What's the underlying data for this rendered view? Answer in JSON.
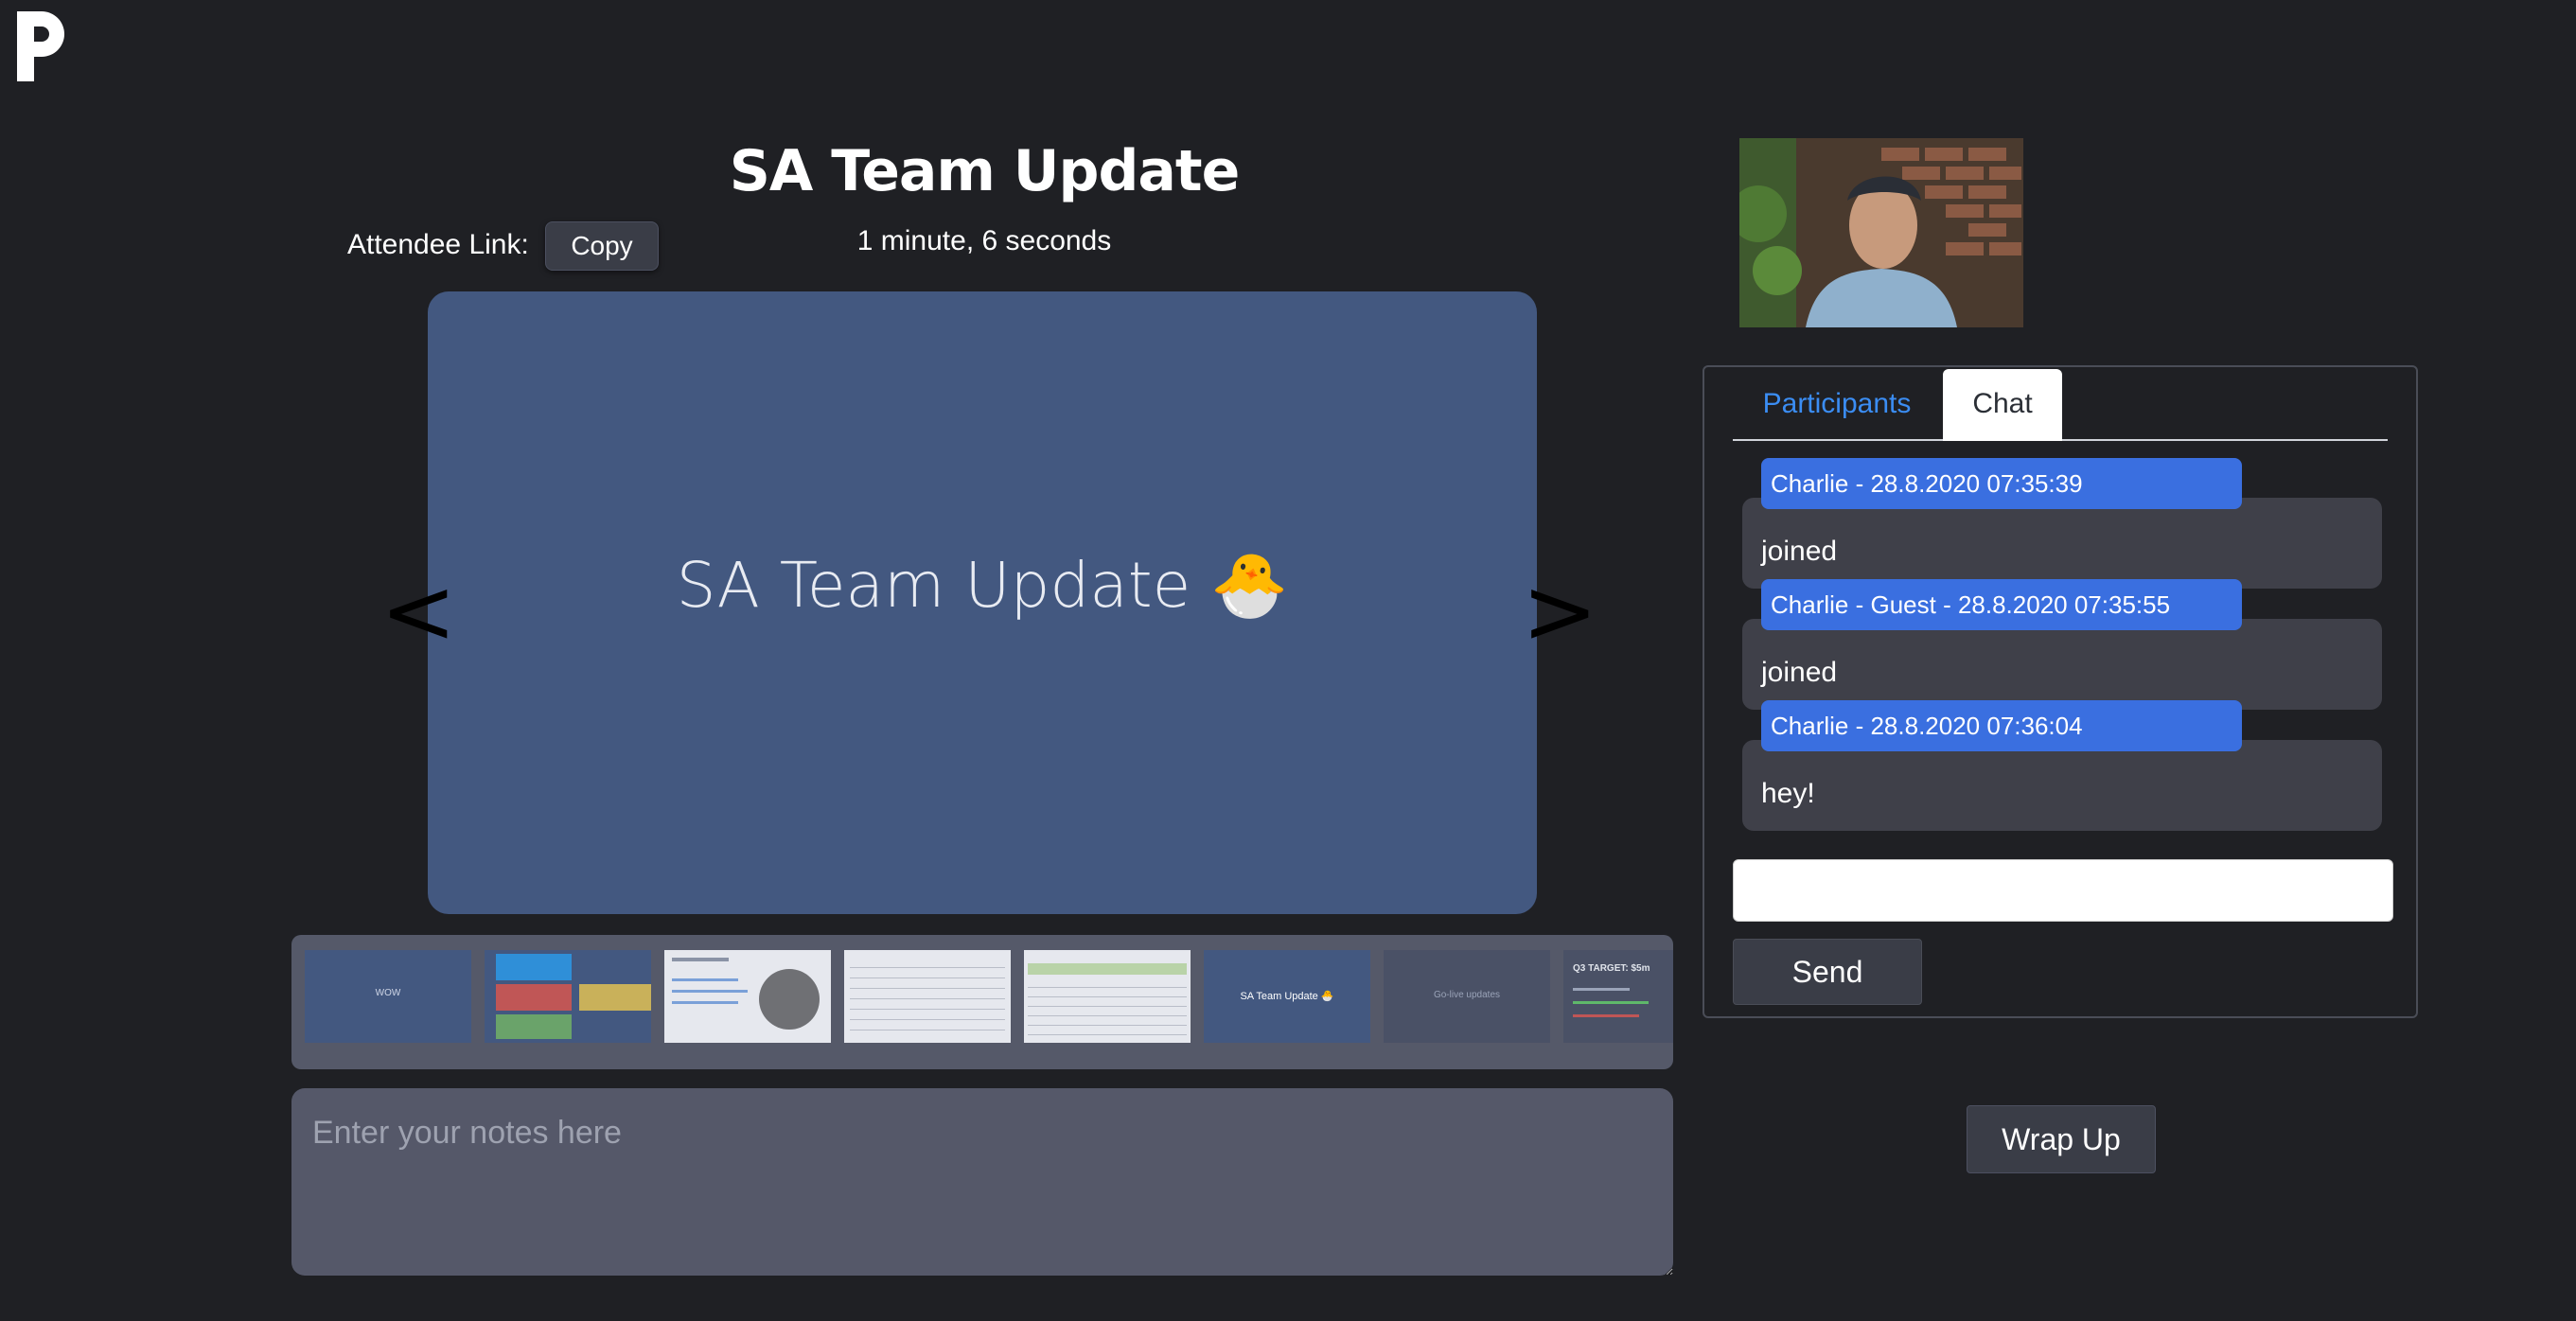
{
  "app": {
    "logo_letter": "P"
  },
  "header": {
    "title": "SA Team Update",
    "attendee_link_label": "Attendee Link:",
    "copy_button_label": "Copy",
    "timer": "1 minute, 6 seconds"
  },
  "slide": {
    "text": "SA Team Update 🐣",
    "prev_symbol": "<",
    "next_symbol": ">"
  },
  "thumbnails": [
    {
      "caption": "WOW"
    },
    {
      "caption": ""
    },
    {
      "caption": ""
    },
    {
      "caption": ""
    },
    {
      "caption": ""
    },
    {
      "caption": "SA Team Update 🐣"
    },
    {
      "caption": "Go-live updates"
    },
    {
      "caption": "Q3 TARGET: $5m"
    }
  ],
  "notes": {
    "placeholder": "Enter your notes here"
  },
  "panel": {
    "tabs": [
      {
        "label": "Participants"
      },
      {
        "label": "Chat"
      }
    ],
    "messages": [
      {
        "header": "Charlie - 28.8.2020 07:35:39",
        "text": "joined"
      },
      {
        "header": "Charlie - Guest - 28.8.2020 07:35:55",
        "text": "joined"
      },
      {
        "header": "Charlie - 28.8.2020 07:36:04",
        "text": "hey!"
      }
    ],
    "input_value": "",
    "send_label": "Send"
  },
  "footer": {
    "wrap_up_label": "Wrap Up"
  },
  "colors": {
    "background": "#1f2024",
    "slide": "#435880",
    "accent_blue": "#3a6fe0",
    "tab_active_link": "#3b8df3"
  }
}
